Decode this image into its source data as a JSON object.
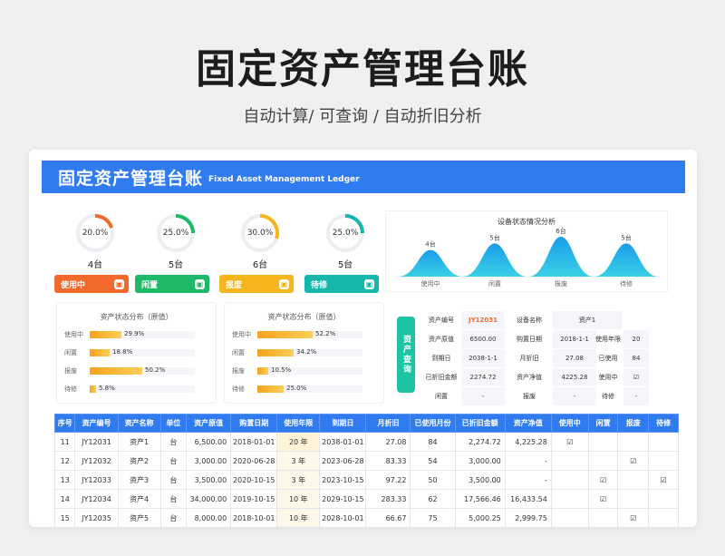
{
  "header": {
    "title": "固定资产管理台账",
    "subtitle": "自动计算/  可查询  / 自动折旧分析"
  },
  "banner": {
    "title": "固定资产管理台账",
    "subtitle_en": "Fixed Asset Management Ledger"
  },
  "summary": [
    {
      "pct": "20.0%",
      "fraction": 0.2,
      "count": "4台",
      "label": "使用中",
      "color": "#f26a2b",
      "ring": "#f26a2b"
    },
    {
      "pct": "25.0%",
      "fraction": 0.25,
      "count": "5台",
      "label": "闲置",
      "color": "#1db969",
      "ring": "#1db969"
    },
    {
      "pct": "30.0%",
      "fraction": 0.3,
      "count": "6台",
      "label": "报废",
      "color": "#f7b51d",
      "ring": "#f7b51d"
    },
    {
      "pct": "25.0%",
      "fraction": 0.25,
      "count": "5台",
      "label": "待修",
      "color": "#17b6ad",
      "ring": "#17b6ad"
    }
  ],
  "equipment_chart": {
    "title": "设备状态情况分析",
    "items": [
      {
        "label": "使用中",
        "value": "4台",
        "v": 4
      },
      {
        "label": "闲置",
        "value": "5台",
        "v": 5
      },
      {
        "label": "报废",
        "value": "6台",
        "v": 6
      },
      {
        "label": "待修",
        "value": "5台",
        "v": 5
      }
    ]
  },
  "bar_cards": [
    {
      "title": "资产状态分布（原值）",
      "rows": [
        {
          "label": "使用中",
          "value": "29.9%",
          "v": 29.9
        },
        {
          "label": "闲置",
          "value": "18.8%",
          "v": 18.8
        },
        {
          "label": "报废",
          "value": "50.2%",
          "v": 50.2
        },
        {
          "label": "待修",
          "value": "5.8%",
          "v": 5.8
        }
      ]
    },
    {
      "title": "资产状态分布（原值）",
      "rows": [
        {
          "label": "使用中",
          "value": "52.2%",
          "v": 52.2
        },
        {
          "label": "闲置",
          "value": "34.2%",
          "v": 34.2
        },
        {
          "label": "报废",
          "value": "10.5%",
          "v": 10.5
        },
        {
          "label": "待修",
          "value": "25.0%",
          "v": 25.0
        }
      ]
    }
  ],
  "detail": {
    "side_label": "资产查询",
    "r1": [
      "资产编号",
      "JY12031",
      "设备名称",
      "资产1",
      "",
      ""
    ],
    "r2": [
      "资产原值",
      "6500.00",
      "购置日期",
      "2018-1-1",
      "使用年限",
      "20"
    ],
    "r3": [
      "到期日",
      "2038-1-1",
      "月折旧",
      "27.08",
      "已使用",
      "84"
    ],
    "r4": [
      "已折旧金额",
      "2274.72",
      "资产净值",
      "4225.28",
      "使用中",
      "☑"
    ],
    "r5": [
      "闲置",
      "-",
      "报废",
      "-",
      "待修",
      "-"
    ]
  },
  "table": {
    "headers": [
      "序号",
      "资产编号",
      "资产名称",
      "单位",
      "资产原值",
      "购置日期",
      "使用年限",
      "到期日",
      "月折旧",
      "已使用月份",
      "已折旧金额",
      "资产净值",
      "使用中",
      "闲置",
      "报废",
      "待修"
    ],
    "rows": [
      [
        "11",
        "JY12031",
        "资产1",
        "台",
        "6,500.00",
        "2018-01-01",
        "20 年",
        "2038-01-01",
        "27.08",
        "84",
        "2,274.72",
        "4,225.28",
        "☑",
        "",
        "",
        ""
      ],
      [
        "12",
        "JY12032",
        "资产2",
        "台",
        "3,000.00",
        "2020-06-28",
        "3 年",
        "2023-06-28",
        "83.33",
        "54",
        "3,000.00",
        "-",
        "",
        "",
        "☑",
        ""
      ],
      [
        "13",
        "JY12033",
        "资产3",
        "台",
        "3,500.00",
        "2020-10-15",
        "3 年",
        "2023-10-15",
        "97.22",
        "50",
        "3,500.00",
        "-",
        "",
        "☑",
        "",
        "☑"
      ],
      [
        "14",
        "JY12034",
        "资产4",
        "台",
        "34,000.00",
        "2019-10-15",
        "10 年",
        "2029-10-15",
        "283.33",
        "62",
        "17,566.46",
        "16,433.54",
        "",
        "☑",
        "",
        ""
      ],
      [
        "15",
        "JY12035",
        "资产5",
        "台",
        "8,000.00",
        "2018-10-01",
        "10 年",
        "2028-10-01",
        "66.67",
        "75",
        "5,000.25",
        "2,999.75",
        "",
        "",
        "☑",
        ""
      ]
    ]
  }
}
